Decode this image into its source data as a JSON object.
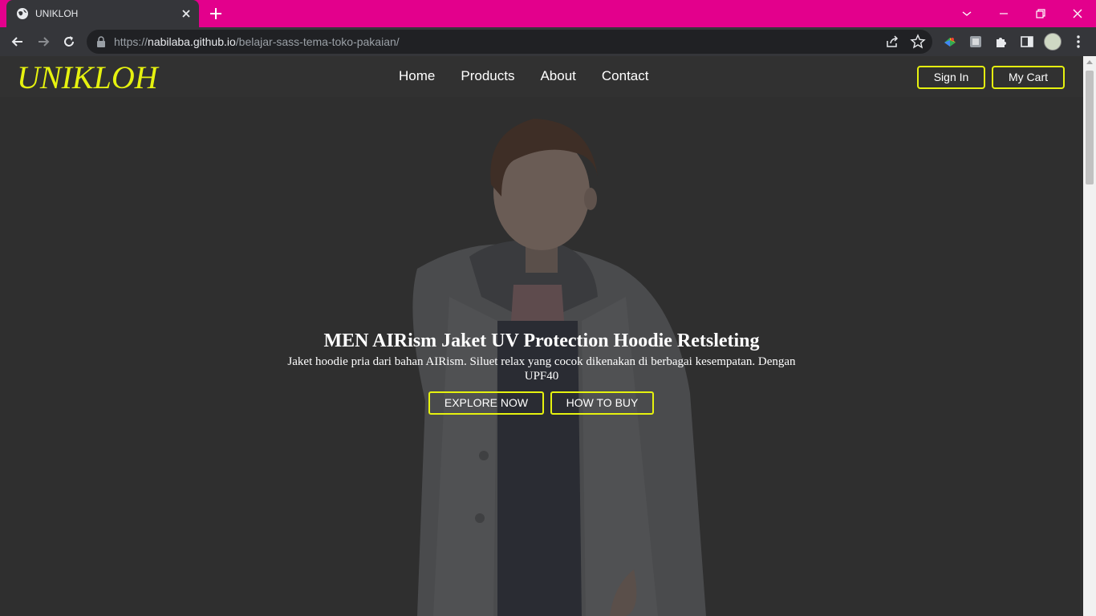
{
  "browser": {
    "tab_title": "UNIKLOH",
    "url_scheme": "https://",
    "url_host": "nabilaba.github.io",
    "url_path": "/belajar-sass-tema-toko-pakaian/",
    "tabstrip_color": "#e3008c"
  },
  "site": {
    "logo": "UNIKLOH",
    "accent_color": "#e6f20f",
    "nav": [
      "Home",
      "Products",
      "About",
      "Contact"
    ],
    "sign_in_label": "Sign In",
    "cart_label": "My Cart"
  },
  "hero": {
    "title": "MEN AIRism Jaket UV Protection Hoodie Retsleting",
    "description": "Jaket hoodie pria dari bahan AIRism. Siluet relax yang cocok dikenakan di berbagai kesempatan. Dengan UPF40",
    "explore_label": "EXPLORE NOW",
    "howto_label": "HOW TO BUY"
  }
}
